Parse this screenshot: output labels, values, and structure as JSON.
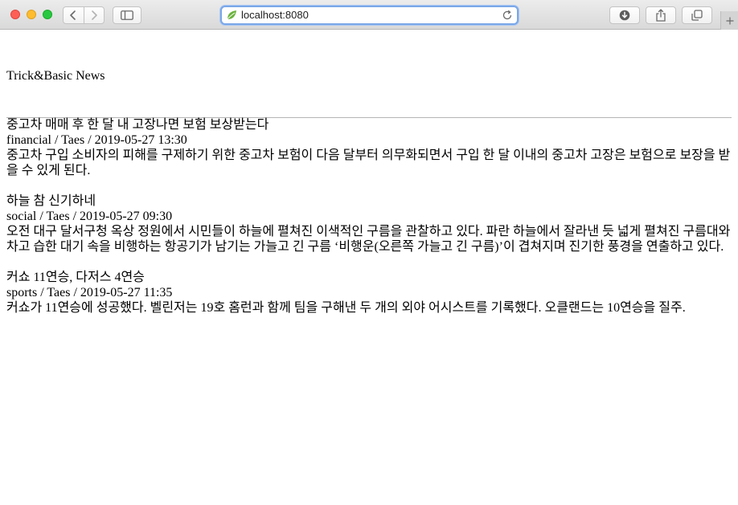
{
  "browser": {
    "url": "localhost:8080"
  },
  "page": {
    "title": "Trick&Basic News",
    "articles": [
      {
        "headline": "중고차 매매 후 한 달 내 고장나면 보험 보상받는다",
        "category": "financial",
        "author": "Taes",
        "date": "2019-05-27 13:30",
        "meta": "financial / Taes / 2019-05-27 13:30",
        "body": "중고차 구입 소비자의 피해를 구제하기 위한 중고차 보험이 다음 달부터 의무화되면서 구입 한 달 이내의 중고차 고장은 보험으로 보장을 받을 수 있게 된다."
      },
      {
        "headline": "하늘 참 신기하네",
        "category": "social",
        "author": "Taes",
        "date": "2019-05-27 09:30",
        "meta": "social / Taes / 2019-05-27 09:30",
        "body": "오전 대구 달서구청 옥상 정원에서 시민들이 하늘에 펼쳐진 이색적인 구름을 관찰하고 있다. 파란 하늘에서 잘라낸 듯 넓게 펼쳐진 구름대와 차고 습한 대기 속을 비행하는 항공기가 남기는 가늘고 긴 구름 ‘비행운(오른쪽 가늘고 긴 구름)’이 겹쳐지며 진기한 풍경을 연출하고 있다."
      },
      {
        "headline": "커쇼 11연승, 다저스 4연승",
        "category": "sports",
        "author": "Taes",
        "date": "2019-05-27 11:35",
        "meta": "sports / Taes / 2019-05-27 11:35",
        "body": "커쇼가 11연승에 성공했다. 벨린저는 19호 홈런과 함께 팀을 구해낸 두 개의 외야 어시스트를 기록했다. 오클랜드는 10연승을 질주."
      }
    ]
  }
}
